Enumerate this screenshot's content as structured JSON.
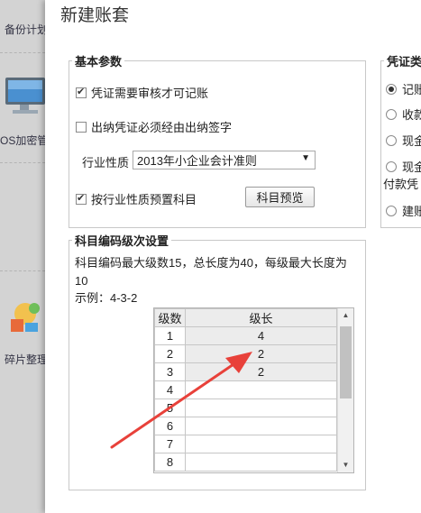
{
  "background_app": {
    "items": [
      {
        "label": "备份计划",
        "icon": "backup-icon"
      },
      {
        "label": "OS加密管",
        "icon": "monitor-lock-icon"
      },
      {
        "label": "碎片整理",
        "icon": "defrag-icon"
      }
    ]
  },
  "dialog": {
    "title": "新建账套",
    "basic_params": {
      "legend": "基本参数",
      "require_audit": {
        "label": "凭证需要审核才可记账",
        "checked": true
      },
      "cashier_sign": {
        "label": "出纳凭证必须经由出纳签字",
        "checked": false
      },
      "industry_label": "行业性质",
      "industry_value": "2013年小企业会计准则",
      "preset_accounts": {
        "label": "按行业性质预置科目",
        "checked": true
      },
      "preview_button": "科目预览"
    },
    "voucher_type": {
      "legend": "凭证类",
      "options": [
        {
          "label": "记账",
          "checked": true
        },
        {
          "label": "收款",
          "checked": false
        },
        {
          "label": "现金",
          "checked": false
        },
        {
          "label": "现金",
          "checked": false
        },
        {
          "label": "建账",
          "checked": false
        }
      ],
      "extra_text": "付款凭"
    },
    "account_levels": {
      "legend": "科目编码级次设置",
      "info_line1": "科目编码最大级数15，总长度为40，每级最大长度为",
      "info_line2": "10",
      "example": "示例：4-3-2",
      "columns": [
        "级数",
        "级长"
      ],
      "rows": [
        {
          "level": "1",
          "length": "4"
        },
        {
          "level": "2",
          "length": "2"
        },
        {
          "level": "3",
          "length": "2"
        },
        {
          "level": "4",
          "length": ""
        },
        {
          "level": "5",
          "length": ""
        },
        {
          "level": "6",
          "length": ""
        },
        {
          "level": "7",
          "length": ""
        },
        {
          "level": "8",
          "length": ""
        }
      ]
    }
  },
  "annotation_color": "#e8413a"
}
